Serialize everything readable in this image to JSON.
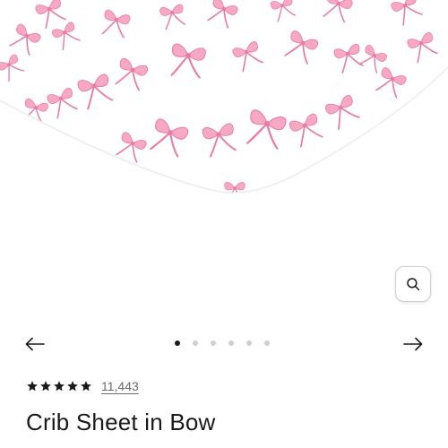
{
  "product": {
    "title": "Crib Sheet in Bow",
    "rating_stars": 5,
    "review_count": "11,443"
  },
  "gallery": {
    "image_count": 6,
    "active_index": 0,
    "zoom_icon": "search-icon",
    "prev_icon": "arrow-left-icon",
    "next_icon": "arrow-right-icon"
  },
  "colors": {
    "bow_pink": "#f28bb0",
    "sheet_white": "#ffffff",
    "text_dark": "#1a1a1a",
    "dot_inactive": "#cfcfcf"
  }
}
